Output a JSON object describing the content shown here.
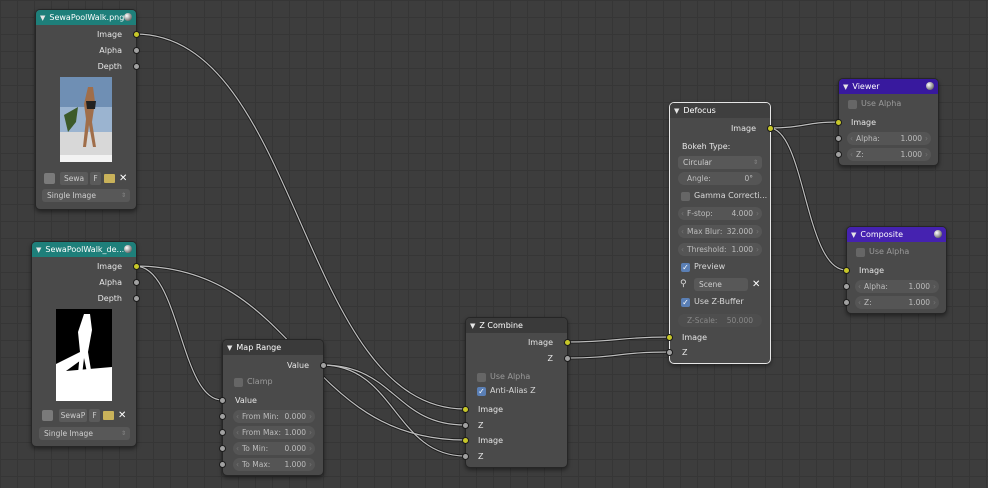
{
  "nodes": {
    "image1": {
      "title": "SewaPoolWalk.png",
      "outputs": [
        "Image",
        "Alpha",
        "Depth"
      ],
      "image_field": "Sewa",
      "f_label": "F",
      "source": "Single Image"
    },
    "image2": {
      "title": "SewaPoolWalk_de...",
      "outputs": [
        "Image",
        "Alpha",
        "Depth"
      ],
      "image_field": "SewaP",
      "f_label": "F",
      "source": "Single Image"
    },
    "map_range": {
      "title": "Map Range",
      "output": "Value",
      "clamp_label": "Clamp",
      "input_label": "Value",
      "fields": [
        {
          "label": "From Min:",
          "value": "0.000"
        },
        {
          "label": "From Max:",
          "value": "1.000"
        },
        {
          "label": "To Min:",
          "value": "0.000"
        },
        {
          "label": "To Max:",
          "value": "1.000"
        }
      ]
    },
    "z_combine": {
      "title": "Z Combine",
      "outputs": [
        "Image",
        "Z"
      ],
      "use_alpha": "Use Alpha",
      "anti_alias": "Anti-Alias Z",
      "inputs": [
        "Image",
        "Z",
        "Image",
        "Z"
      ]
    },
    "defocus": {
      "title": "Defocus",
      "output": "Image",
      "bokeh_label": "Bokeh Type:",
      "bokeh_value": "Circular",
      "angle_label": "Angle:",
      "angle_value": "0°",
      "gamma_label": "Gamma Correcti...",
      "fstop_label": "F-stop:",
      "fstop_value": "4.000",
      "maxblur_label": "Max Blur:",
      "maxblur_value": "32.000",
      "threshold_label": "Threshold:",
      "threshold_value": "1.000",
      "preview_label": "Preview",
      "scene_value": "Scene",
      "use_zbuffer": "Use Z-Buffer",
      "zscale_label": "Z-Scale:",
      "zscale_value": "50.000",
      "inputs": [
        "Image",
        "Z"
      ]
    },
    "viewer": {
      "title": "Viewer",
      "use_alpha": "Use Alpha",
      "input": "Image",
      "alpha_label": "Alpha:",
      "alpha_value": "1.000",
      "z_label": "Z:",
      "z_value": "1.000"
    },
    "composite": {
      "title": "Composite",
      "use_alpha": "Use Alpha",
      "input": "Image",
      "alpha_label": "Alpha:",
      "alpha_value": "1.000",
      "z_label": "Z:",
      "z_value": "1.000"
    }
  },
  "colors": {
    "grid_bg": "#3d3d3d",
    "input_node_header": "#1e7f7a",
    "output_node_header": "#38199e",
    "image_socket": "#c7c729",
    "value_socket": "#a1a1a1"
  },
  "icons": [
    "collapse-triangle-icon",
    "render-ball-icon",
    "image-browse-icon",
    "folder-open-icon",
    "close-icon",
    "checkbox-icon",
    "scene-icon"
  ]
}
